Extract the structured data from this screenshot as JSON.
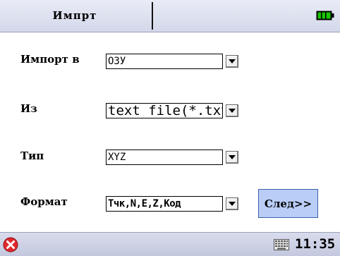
{
  "header": {
    "title": "Импрт",
    "battery_icon": "battery-full-icon",
    "accent_color": "#0b8a00"
  },
  "form": {
    "import_to": {
      "label": "Импорт в",
      "value": "ОЗУ"
    },
    "from": {
      "label": "Из",
      "value": "text file(*.txt)"
    },
    "type": {
      "label": "Тип",
      "value": "XYZ"
    },
    "format": {
      "label": "Формат",
      "value": "Тчк,N,E,Z,Код"
    }
  },
  "actions": {
    "next_label": "След>>"
  },
  "taskbar": {
    "close_icon": "close-icon",
    "keyboard_icon": "keyboard-icon",
    "time": "11:35"
  }
}
